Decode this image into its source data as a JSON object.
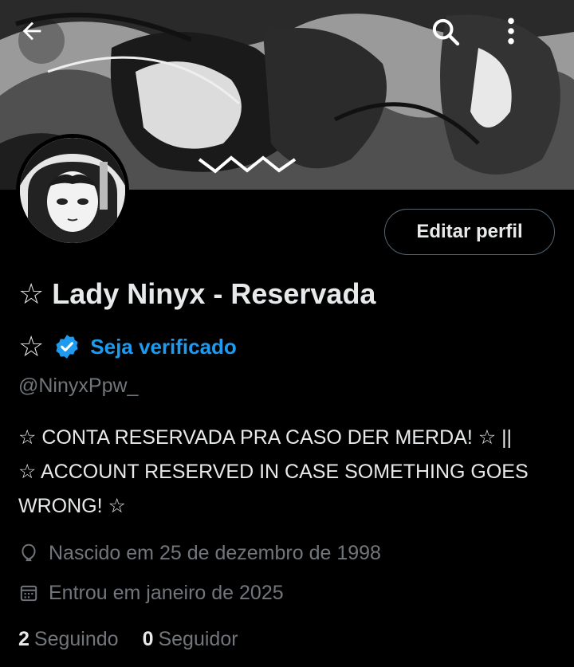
{
  "header": {
    "back_icon": "arrow-left-icon",
    "search_icon": "search-icon",
    "more_icon": "more-vertical-icon"
  },
  "profile": {
    "edit_label": "Editar perfil",
    "display_name": "☆ Lady Ninyx - Reservada",
    "star_badge": "☆",
    "verify_label": "Seja verificado",
    "handle": "@NinyxPpw_",
    "bio_lines": [
      "☆ CONTA RESERVADA PRA CASO DER MERDA! ☆ ||",
      "☆ ACCOUNT RESERVED IN CASE SOMETHING GOES",
      "WRONG! ☆"
    ],
    "birth": "Nascido em 25 de dezembro de 1998",
    "joined": "Entrou em janeiro de 2025",
    "following_count": "2",
    "following_label": "Seguindo",
    "followers_count": "0",
    "followers_label": "Seguidor"
  },
  "colors": {
    "background": "#000000",
    "primary_text": "#e7e9ea",
    "secondary_text": "#71767b",
    "accent": "#1d9bf0",
    "border": "#536471"
  }
}
